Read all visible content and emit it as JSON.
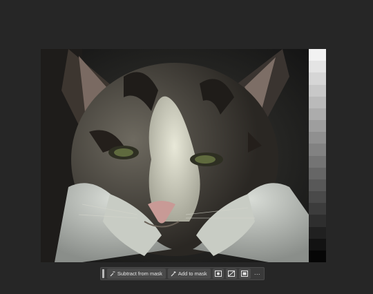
{
  "canvas": {
    "background": "#262626",
    "image_subject": "tabby-white-cat-closeup"
  },
  "gray_strip": {
    "shades": [
      "#f2f2f2",
      "#e4e4e4",
      "#d6d6d6",
      "#c8c8c8",
      "#bababa",
      "#acacac",
      "#9e9e9e",
      "#909090",
      "#828282",
      "#747474",
      "#666666",
      "#585858",
      "#4a4a4a",
      "#3c3c3c",
      "#2e2e2e",
      "#202020",
      "#121212",
      "#060606"
    ]
  },
  "toolbar": {
    "subtract_label": "Subtract from mask",
    "add_label": "Add to mask",
    "more_label": "···",
    "icons": [
      "brush-minus-icon",
      "brush-plus-icon",
      "mask-overlay-icon",
      "invert-mask-icon",
      "mask-options-icon"
    ]
  }
}
